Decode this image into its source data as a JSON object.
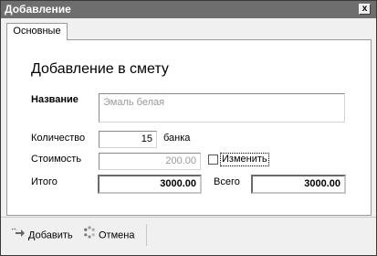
{
  "window": {
    "title": "Добавление",
    "close_label": "x"
  },
  "tabs": [
    {
      "label": "Основные"
    }
  ],
  "form": {
    "heading": "Добавление в смету",
    "name": {
      "label": "Название",
      "value": "Эмаль белая"
    },
    "quantity": {
      "label": "Количество",
      "value": "15",
      "unit": "банка"
    },
    "cost": {
      "label": "Стоимость",
      "value": "200.00"
    },
    "change": {
      "label": "Изменить",
      "checked": false
    },
    "subtotal": {
      "label": "Итого",
      "value": "3000.00"
    },
    "total": {
      "label": "Всего",
      "value": "3000.00"
    }
  },
  "footer": {
    "add_label": "Добавить",
    "cancel_label": "Отмена",
    "add_icon": "add-arrow-icon",
    "cancel_icon": "cancel-icon"
  }
}
